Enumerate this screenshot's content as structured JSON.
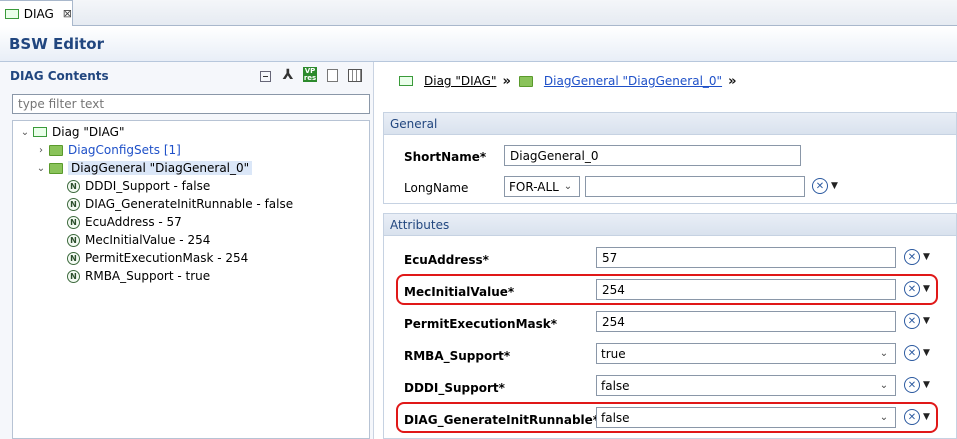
{
  "tab": {
    "label": "DIAG",
    "close": "⊠"
  },
  "editor": {
    "title": "BSW Editor"
  },
  "left": {
    "title": "DIAG Contents",
    "filter_placeholder": "type filter text",
    "tools": {
      "vp_top": "VP",
      "vp_bottom": "res"
    },
    "tree": [
      {
        "label": "Diag \"DIAG\""
      },
      {
        "label": "DiagConfigSets [1]"
      },
      {
        "label": "DiagGeneral \"DiagGeneral_0\""
      },
      {
        "label": "DDDI_Support - false"
      },
      {
        "label": "DIAG_GenerateInitRunnable - false"
      },
      {
        "label": "EcuAddress - 57"
      },
      {
        "label": "MecInitialValue - 254"
      },
      {
        "label": "PermitExecutionMask - 254"
      },
      {
        "label": "RMBA_Support - true"
      }
    ],
    "param_icon_letter": "N"
  },
  "breadcrumb": {
    "item1": "Diag \"DIAG\"",
    "item2": "DiagGeneral \"DiagGeneral_0\"",
    "sep": "»"
  },
  "general": {
    "header": "General",
    "shortname_label": "ShortName*",
    "shortname_value": "DiagGeneral_0",
    "longname_label": "LongName",
    "longname_lang": "FOR-ALL",
    "longname_value": ""
  },
  "attributes": {
    "header": "Attributes",
    "rows": [
      {
        "label": "EcuAddress*",
        "value": "57"
      },
      {
        "label": "MecInitialValue*",
        "value": "254"
      },
      {
        "label": "PermitExecutionMask*",
        "value": "254"
      },
      {
        "label": "RMBA_Support*",
        "value": "true"
      },
      {
        "label": "DDDI_Support*",
        "value": "false"
      },
      {
        "label": "DIAG_GenerateInitRunnable*",
        "value": "false"
      }
    ]
  }
}
